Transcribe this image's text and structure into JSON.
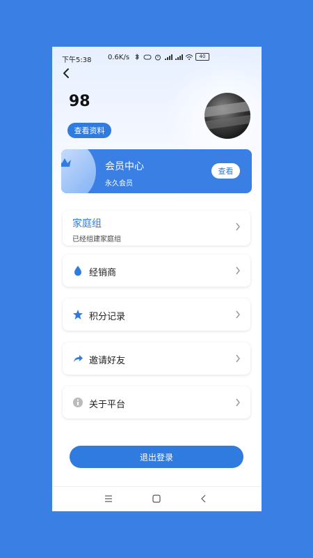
{
  "status_bar": {
    "time": "下午5:38",
    "net_speed": "0.6K/s",
    "battery": "40"
  },
  "profile": {
    "user_id": "98",
    "view_profile_label": "查看资料"
  },
  "vip": {
    "title": "会员中心",
    "subtitle": "永久会员",
    "view_label": "查看"
  },
  "menu": {
    "family": {
      "title": "家庭组",
      "subtitle": "已经组建家庭组"
    },
    "items": [
      {
        "label": "经销商",
        "icon": "drop-icon"
      },
      {
        "label": "积分记录",
        "icon": "star-icon"
      },
      {
        "label": "邀请好友",
        "icon": "share-icon"
      },
      {
        "label": "关于平台",
        "icon": "info-icon"
      }
    ]
  },
  "logout_label": "退出登录",
  "colors": {
    "primary": "#2f7be0",
    "background": "#3a7fe4"
  }
}
